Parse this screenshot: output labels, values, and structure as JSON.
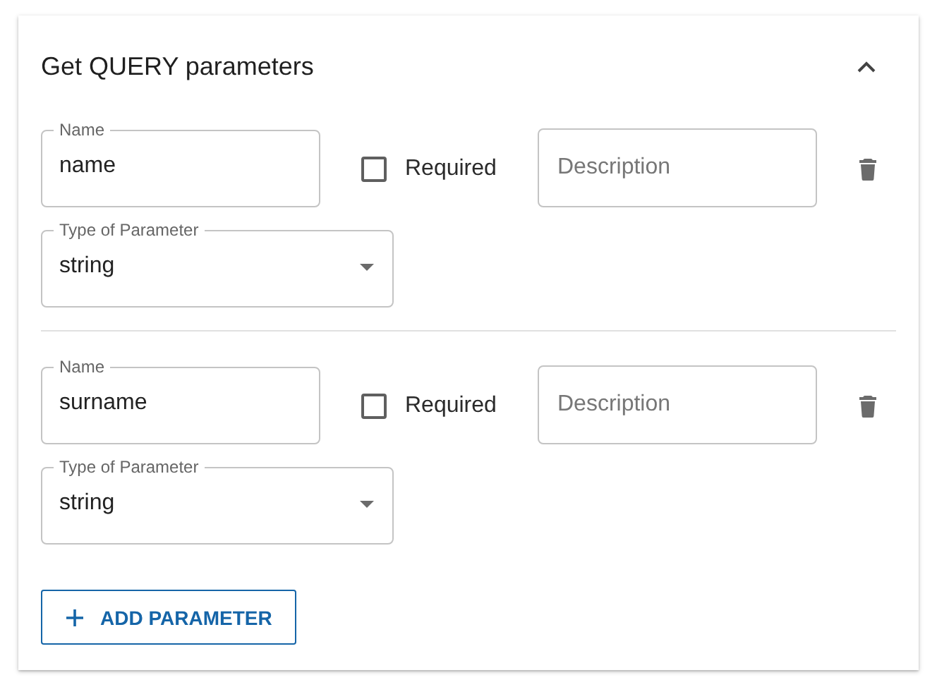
{
  "panel": {
    "title": "Get QUERY parameters",
    "expanded": true
  },
  "parameters": [
    {
      "name_label": "Name",
      "name": "name",
      "required": false,
      "required_label": "Required",
      "description_placeholder": "Description",
      "type_label": "Type of Parameter",
      "type": "string"
    },
    {
      "name_label": "Name",
      "name": "surname",
      "required": false,
      "required_label": "Required",
      "description_placeholder": "Description",
      "type_label": "Type of Parameter",
      "type": "string"
    }
  ],
  "add_button": {
    "label": "ADD PARAMETER"
  }
}
